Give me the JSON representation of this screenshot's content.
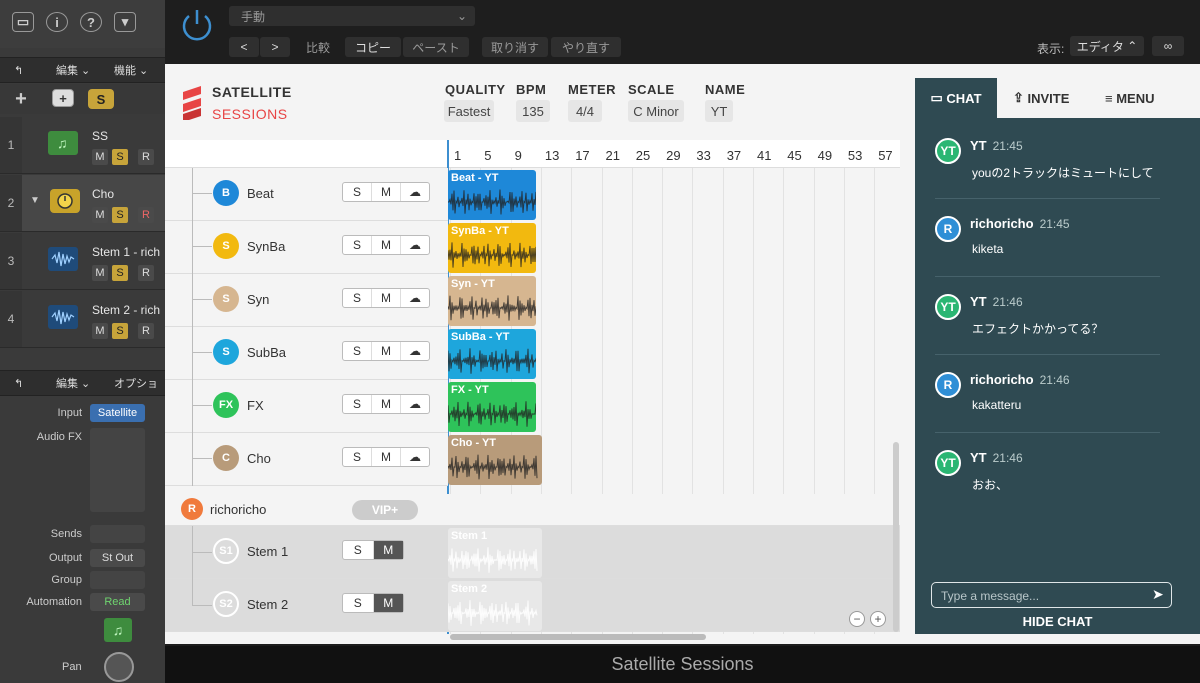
{
  "daw": {
    "toolbar1": {
      "edit": "編集",
      "func": "機能"
    },
    "tracks": [
      {
        "num": "1",
        "name": "SS",
        "m": "M",
        "s": "S",
        "r": "R"
      },
      {
        "num": "2",
        "name": "Cho",
        "m": "M",
        "s": "S",
        "r": "R"
      },
      {
        "num": "3",
        "name": "Stem 1 - rich",
        "m": "M",
        "s": "S",
        "r": "R"
      },
      {
        "num": "4",
        "name": "Stem 2 - rich",
        "m": "M",
        "s": "S",
        "r": "R"
      }
    ],
    "toolbar2": {
      "edit": "編集",
      "option": "オプショ"
    },
    "labels": {
      "input": "Input",
      "audiofx": "Audio FX",
      "sends": "Sends",
      "output": "Output",
      "group": "Group",
      "automation": "Automation",
      "pan": "Pan"
    },
    "values": {
      "input": "Satellite",
      "output": "St Out",
      "automation": "Read"
    },
    "s_button": "S"
  },
  "plugin": {
    "preset": "手動",
    "compare": "比較",
    "copy": "コピー",
    "paste": "ペースト",
    "undo": "取り消す",
    "redo": "やり直す",
    "view_label": "表示:",
    "view_value": "エディタ",
    "footer": "Satellite Sessions"
  },
  "app": {
    "logo_top": "SATELLITE",
    "logo_bottom": "SESSIONS",
    "quality": {
      "label": "QUALITY",
      "value": "Fastest"
    },
    "bpm": {
      "label": "BPM",
      "value": "135"
    },
    "meter": {
      "label": "METER",
      "value": "4/4"
    },
    "scale": {
      "label": "SCALE",
      "value": "C Minor"
    },
    "name": {
      "label": "NAME",
      "value": "YT"
    },
    "ruler": [
      "1",
      "5",
      "9",
      "13",
      "17",
      "21",
      "25",
      "29",
      "33",
      "37",
      "41",
      "45",
      "49",
      "53",
      "57"
    ],
    "tracks": [
      {
        "badge": "B",
        "name": "Beat",
        "color": "#1e88d8",
        "clip": "Beat - YT",
        "s": "S",
        "m": "M"
      },
      {
        "badge": "S",
        "name": "SynBa",
        "color": "#f2b90f",
        "clip": "SynBa - YT",
        "s": "S",
        "m": "M"
      },
      {
        "badge": "S",
        "name": "Syn",
        "color": "#d6b690",
        "clip": "Syn - YT",
        "s": "S",
        "m": "M"
      },
      {
        "badge": "S",
        "name": "SubBa",
        "color": "#1ea6dc",
        "clip": "SubBa - YT",
        "s": "S",
        "m": "M"
      },
      {
        "badge": "FX",
        "name": "FX",
        "color": "#2ec35a",
        "clip": "FX - YT",
        "s": "S",
        "m": "M"
      },
      {
        "badge": "C",
        "name": "Cho",
        "color": "#b89b7a",
        "clip": "Cho - YT",
        "s": "S",
        "m": "M"
      }
    ],
    "user": {
      "badge": "R",
      "name": "richoricho",
      "vip": "VIP+"
    },
    "stems": [
      {
        "badge": "S1",
        "name": "Stem 1",
        "clip": "Stem 1",
        "s": "S",
        "m": "M"
      },
      {
        "badge": "S2",
        "name": "Stem 2",
        "clip": "Stem 2",
        "s": "S",
        "m": "M"
      }
    ],
    "zoom_out": "−",
    "zoom_in": "+"
  },
  "chat": {
    "tabs": {
      "chat": "CHAT",
      "invite": "INVITE",
      "menu": "MENU"
    },
    "messages": [
      {
        "avatar": "YT",
        "name": "YT",
        "time": "21:45",
        "text": "youの2トラックはミュートにして"
      },
      {
        "avatar": "R",
        "name": "richoricho",
        "time": "21:45",
        "text": "kiketa"
      },
      {
        "avatar": "YT",
        "name": "YT",
        "time": "21:46",
        "text": "エフェクトかかってる？"
      },
      {
        "avatar": "R",
        "name": "richoricho",
        "time": "21:46",
        "text": "kakatteru"
      },
      {
        "avatar": "YT",
        "name": "YT",
        "time": "21:46",
        "text": "おお、"
      }
    ],
    "placeholder": "Type a message...",
    "hide": "HIDE CHAT"
  },
  "colors": {
    "yt": "#2bb673",
    "r": "#2f8fd6",
    "accent": "#e84545",
    "chatbg": "#2f4a52"
  }
}
